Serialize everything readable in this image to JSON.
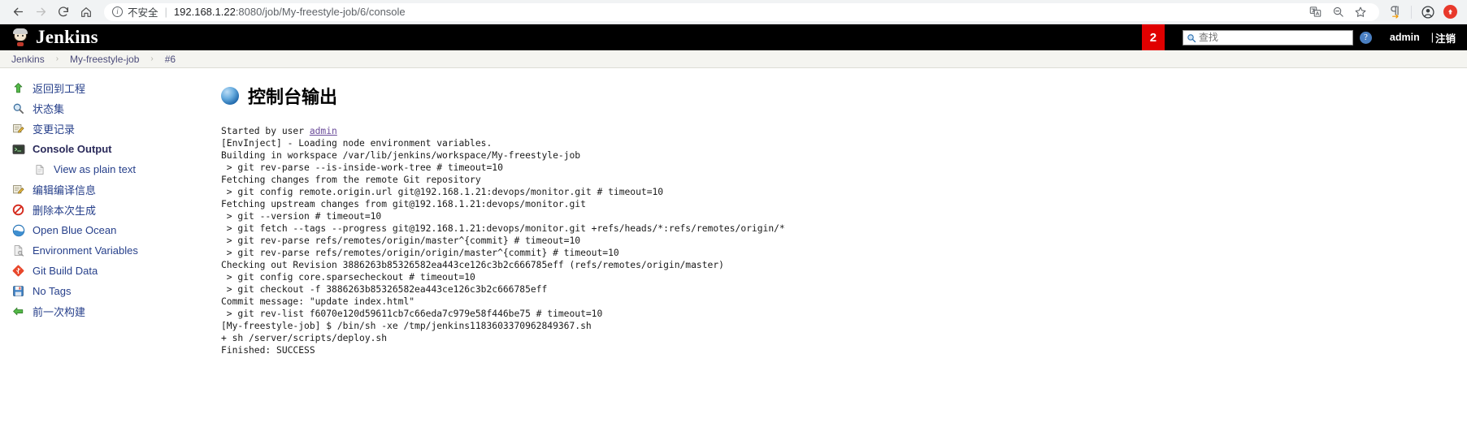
{
  "browser": {
    "back_icon": "back-arrow-icon",
    "forward_icon": "forward-arrow-icon",
    "reload_icon": "reload-icon",
    "home_icon": "home-icon",
    "security_label": "不安全",
    "url_host": "192.168.1.22",
    "url_rest": ":8080/job/My-freestyle-job/6/console",
    "url_full": "192.168.1.22:8080/job/My-freestyle-job/6/console",
    "translate_icon": "translate-icon",
    "zoom_out_icon": "zoom-out-icon",
    "bookmark_icon": "star-icon",
    "reading_icon": "pilcrow-icon",
    "profile_icon": "profile-icon",
    "extension_icon": "extension-icon"
  },
  "header": {
    "brand": "Jenkins",
    "logo_icon": "jenkins-butler-icon",
    "error_badge": "2",
    "search_placeholder": "查找",
    "search_value": "",
    "search_icon": "search-icon",
    "help_icon": "help-icon",
    "help_glyph": "?",
    "user": "admin",
    "logout_separator": "|",
    "logout": "注销"
  },
  "breadcrumb": {
    "separator": "›",
    "items": [
      {
        "label": "Jenkins"
      },
      {
        "label": "My-freestyle-job"
      },
      {
        "label": "#6"
      }
    ]
  },
  "sidebar": {
    "items": [
      {
        "label": "返回到工程",
        "icon": "up-arrow-icon",
        "active": false,
        "sub": false
      },
      {
        "label": "状态集",
        "icon": "magnifier-icon",
        "active": false,
        "sub": false
      },
      {
        "label": "变更记录",
        "icon": "edit-document-icon",
        "active": false,
        "sub": false
      },
      {
        "label": "Console Output",
        "icon": "terminal-icon",
        "active": true,
        "sub": false
      },
      {
        "label": "View as plain text",
        "icon": "plain-document-icon",
        "active": false,
        "sub": true
      },
      {
        "label": "编辑编译信息",
        "icon": "edit-document-icon",
        "active": false,
        "sub": false
      },
      {
        "label": "删除本次生成",
        "icon": "delete-forbidden-icon",
        "active": false,
        "sub": false
      },
      {
        "label": "Open Blue Ocean",
        "icon": "blue-ocean-icon",
        "active": false,
        "sub": false
      },
      {
        "label": "Environment Variables",
        "icon": "document-gear-icon",
        "active": false,
        "sub": false
      },
      {
        "label": "Git Build Data",
        "icon": "git-icon",
        "active": false,
        "sub": false
      },
      {
        "label": "No Tags",
        "icon": "floppy-disk-icon",
        "active": false,
        "sub": false
      },
      {
        "label": "前一次构建",
        "icon": "left-arrow-icon",
        "active": false,
        "sub": false
      }
    ]
  },
  "main": {
    "title": "控制台输出",
    "title_icon": "blue-ball-icon",
    "console": {
      "started_by_prefix": "Started by user ",
      "started_by_user": "admin",
      "lines": [
        "[EnvInject] - Loading node environment variables.",
        "Building in workspace /var/lib/jenkins/workspace/My-freestyle-job",
        " > git rev-parse --is-inside-work-tree # timeout=10",
        "Fetching changes from the remote Git repository",
        " > git config remote.origin.url git@192.168.1.21:devops/monitor.git # timeout=10",
        "Fetching upstream changes from git@192.168.1.21:devops/monitor.git",
        " > git --version # timeout=10",
        " > git fetch --tags --progress git@192.168.1.21:devops/monitor.git +refs/heads/*:refs/remotes/origin/*",
        " > git rev-parse refs/remotes/origin/master^{commit} # timeout=10",
        " > git rev-parse refs/remotes/origin/origin/master^{commit} # timeout=10",
        "Checking out Revision 3886263b85326582ea443ce126c3b2c666785eff (refs/remotes/origin/master)",
        " > git config core.sparsecheckout # timeout=10",
        " > git checkout -f 3886263b85326582ea443ce126c3b2c666785eff",
        "Commit message: \"update index.html\"",
        " > git rev-list f6070e120d59611cb7c66eda7c979e58f446be75 # timeout=10",
        "[My-freestyle-job] $ /bin/sh -xe /tmp/jenkins1183603370962849367.sh",
        "+ sh /server/scripts/deploy.sh",
        "Finished: SUCCESS"
      ]
    }
  },
  "colors": {
    "jenkins_black": "#000000",
    "error_red": "#e00000",
    "link_blue": "#27408b",
    "breadcrumb_bg": "#f4f4f0"
  }
}
